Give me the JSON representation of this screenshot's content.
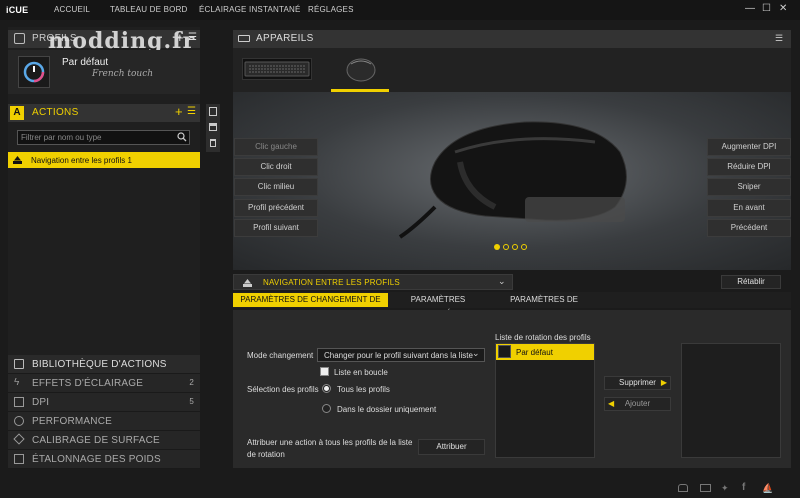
{
  "app": {
    "title": "iCUE"
  },
  "nav": {
    "items": [
      "ACCUEIL",
      "TABLEAU DE BORD",
      "ÉCLAIRAGE INSTANTANÉ",
      "RÉGLAGES"
    ]
  },
  "window": {
    "minimize": "—",
    "maximize": "☐",
    "close": "✕"
  },
  "watermark": "modding.fr",
  "profiles": {
    "header": "PROFILS",
    "current_name": "Par défaut",
    "current_sub": "French touch"
  },
  "actions": {
    "header": "ACTIONS",
    "filter_placeholder": "Filtrer par nom ou type",
    "items": [
      "Navigation entre les profils 1"
    ]
  },
  "library": {
    "items": [
      {
        "label": "BIBLIOTHÈQUE D'ACTIONS",
        "count": ""
      },
      {
        "label": "EFFETS D'ÉCLAIRAGE",
        "count": "2"
      },
      {
        "label": "DPI",
        "count": "5"
      },
      {
        "label": "PERFORMANCE",
        "count": ""
      },
      {
        "label": "CALIBRAGE DE SURFACE",
        "count": ""
      },
      {
        "label": "ÉTALONNAGE DES POIDS",
        "count": ""
      }
    ]
  },
  "devices": {
    "header": "APPAREILS"
  },
  "mouse_buttons": {
    "left": [
      "Clic gauche",
      "Clic droit",
      "Clic milieu",
      "Profil précédent",
      "Profil suivant"
    ],
    "right": [
      "Augmenter DPI",
      "Réduire DPI",
      "Sniper",
      "En avant",
      "Précédent"
    ]
  },
  "action_section": {
    "title": "NAVIGATION ENTRE LES PROFILS",
    "reset_button": "Rétablir",
    "tabs": [
      "PARAMÈTRES DE CHANGEMENT DE PROFIL",
      "PARAMÈTRES AVANCÉS",
      "PARAMÈTRES DE LANCEMENT"
    ],
    "mode_label": "Mode changement",
    "mode_value": "Changer pour le profil suivant dans la liste",
    "loop_label": "Liste en boucle",
    "selection_label": "Sélection des profils",
    "radio_all": "Tous les profils",
    "radio_folder": "Dans le dossier uniquement",
    "assign_label": "Attribuer une action à tous les profils de la liste de rotation",
    "assign_button": "Attribuer",
    "rotation_header": "Liste de rotation des profils",
    "rotation_items": [
      "Par défaut"
    ],
    "delete_button": "Supprimer",
    "add_button": "Ajouter"
  },
  "colors": {
    "accent": "#f0d000",
    "background": "#1b1b1b",
    "panel": "#2a2a2a"
  }
}
